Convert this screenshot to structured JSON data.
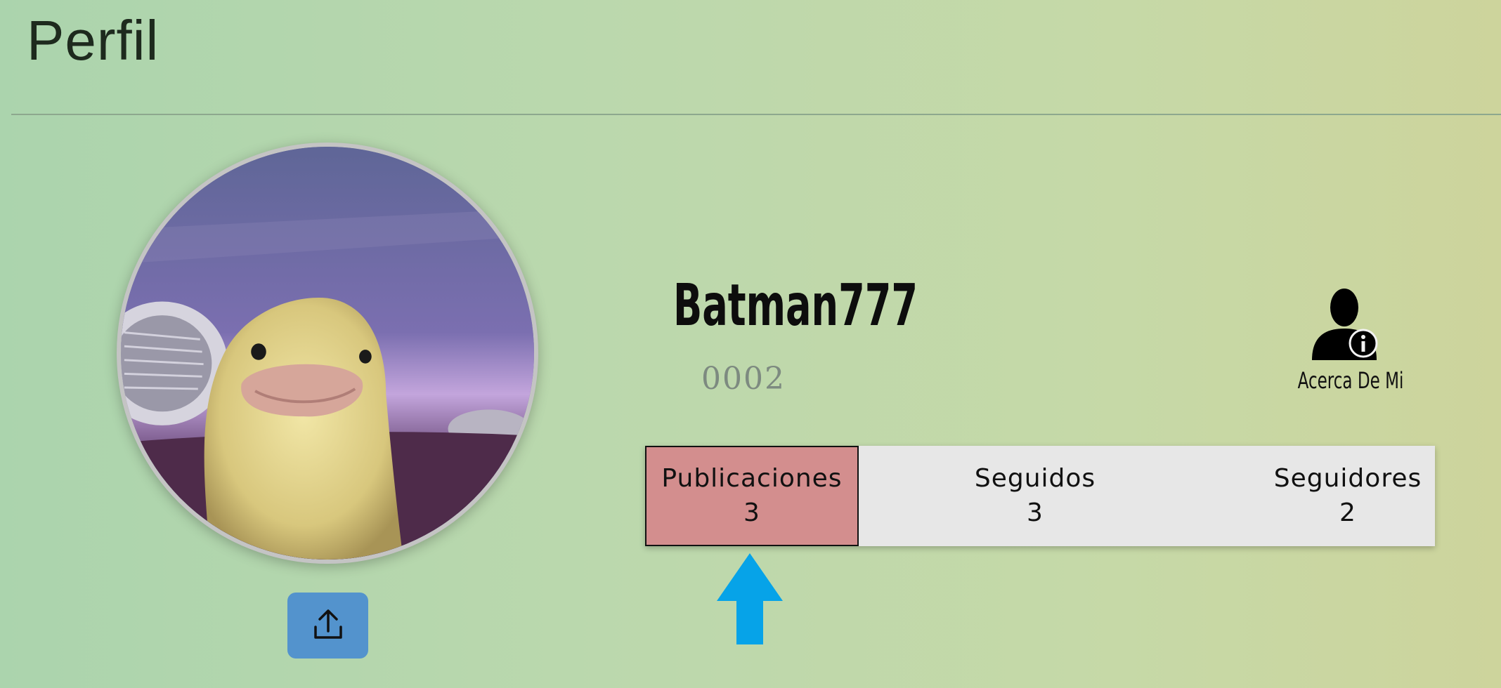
{
  "page": {
    "title": "Perfil"
  },
  "profile": {
    "username": "Batman777",
    "user_id": "0002",
    "about_label": "Acerca De Mi",
    "avatar_description": "duckling-photo"
  },
  "stats": [
    {
      "label": "Publicaciones",
      "value": "3",
      "active": true
    },
    {
      "label": "Seguidos",
      "value": "3",
      "active": false
    },
    {
      "label": "Seguidores",
      "value": "2",
      "active": false
    }
  ],
  "icons": {
    "upload": "upload-icon",
    "about": "user-info-icon",
    "pointer": "arrow-up-icon"
  },
  "colors": {
    "active_tab": "#d38e8e",
    "upload_button": "#5393cd",
    "arrow": "#06a3e8",
    "stats_bg": "#e7e7e7"
  }
}
